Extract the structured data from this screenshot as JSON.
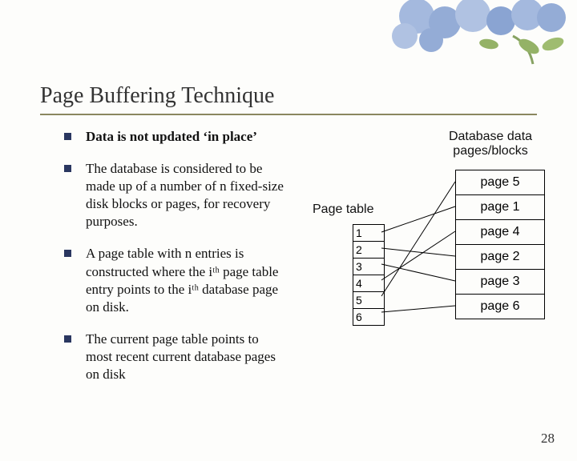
{
  "title": "Page Buffering Technique",
  "bullets": [
    "Data is not updated ‘in place’",
    "The database is considered to be made up of a number of n fixed-size disk blocks or pages, for recovery purposes.",
    "A page table with n entries is constructed where the iᵗʰ page table entry points to the iᵗʰ database page on disk.",
    "The current page table points to most recent current database pages on disk"
  ],
  "diagram": {
    "header_label": "Database data pages/blocks",
    "page_table_label": "Page table",
    "page_table_entries": [
      "1",
      "2",
      "3",
      "4",
      "5",
      "6"
    ],
    "data_pages": [
      "page 5",
      "page 1",
      "page 4",
      "page 2",
      "page 3",
      "page 6"
    ]
  },
  "slide_number": "28",
  "colors": {
    "bullet": "#2a3760",
    "rule": "#8a875f"
  }
}
